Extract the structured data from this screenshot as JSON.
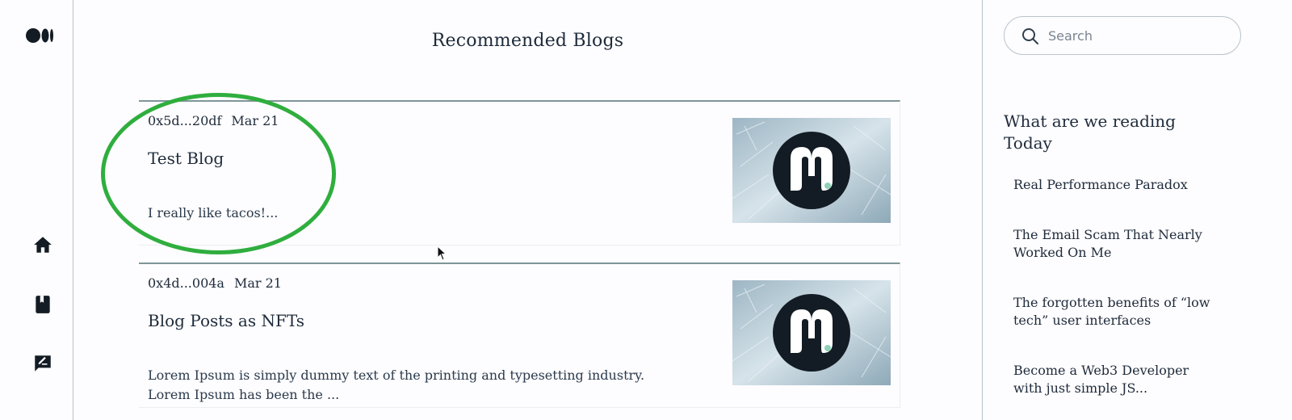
{
  "header": {
    "title": "Recommended Blogs"
  },
  "icons": {
    "logo": "medium-logo-icon",
    "nav": [
      "home-icon",
      "bookmark-icon",
      "write-icon"
    ],
    "search": "search-icon"
  },
  "posts": [
    {
      "author": "0x5d...20df",
      "date": "Mar 21",
      "title": "Test Blog",
      "description": "I really like tacos!..."
    },
    {
      "author": "0x4d...004a",
      "date": "Mar 21",
      "title": "Blog Posts as NFTs",
      "description": "Lorem Ipsum is simply dummy text of the printing and typesetting industry. Lorem Ipsum has been the ..."
    }
  ],
  "search": {
    "placeholder": "Search",
    "value": ""
  },
  "sidebar": {
    "heading": "What are we reading Today",
    "items": [
      "Real Performance Paradox",
      "The Email Scam That Nearly Worked On Me",
      "The forgotten benefits of “low tech” user interfaces",
      "Become a Web3 Developer with just simple JS..."
    ]
  },
  "colors": {
    "background": "#fdfcfe",
    "text": "#1e2b3b",
    "divider": "#7f9598",
    "highlight": "#2fae3e",
    "logo": "#131c24"
  }
}
